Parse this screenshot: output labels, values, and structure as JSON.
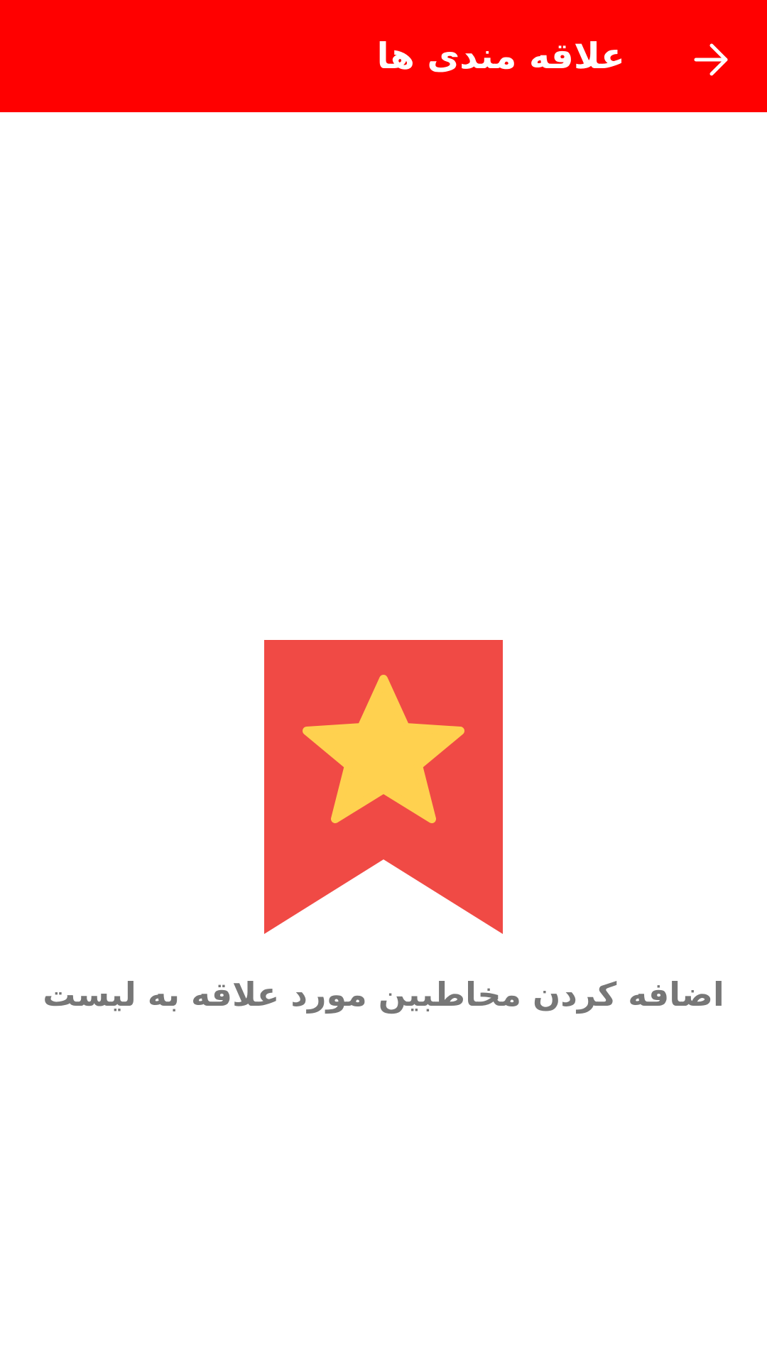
{
  "appbar": {
    "title": "علاقه مندی ها",
    "background_color": "#ff0000",
    "back_icon": "arrow-right-icon"
  },
  "empty_state": {
    "icon": "bookmark-star-icon",
    "bookmark_color": "#f04a45",
    "star_color": "#ffd14f",
    "message": "اضافه کردن مخاطبین مورد علاقه به لیست",
    "message_color": "#777777"
  }
}
